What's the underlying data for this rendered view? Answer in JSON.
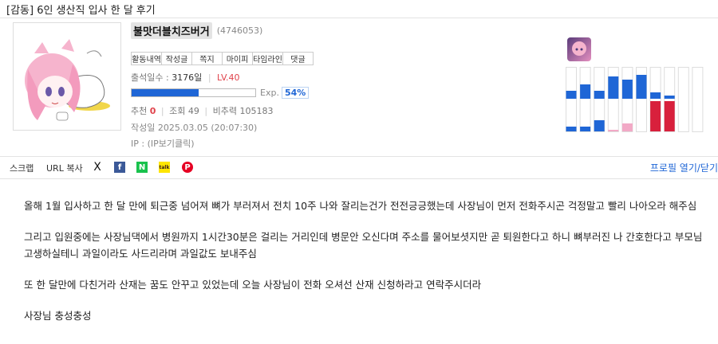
{
  "post": {
    "title": "[감동] 6인 생산직 입사 한 달 후기"
  },
  "author": {
    "nickname": "불맛더블치즈버거",
    "id": "(4746053)",
    "buttons": [
      "활동내역",
      "작성글",
      "쪽지",
      "마이피",
      "타임라인",
      "댓글"
    ],
    "attendance_label": "출석일수 :",
    "attendance_value": "3176일",
    "level": "LV.40",
    "exp_label": "Exp.",
    "exp_percent": "54%",
    "exp_fraction": 0.54
  },
  "stats": {
    "recommend_label": "추천",
    "recommend_value": "0",
    "views_label": "조회",
    "views_value": "49",
    "ratio_label": "비추력",
    "ratio_value": "105183"
  },
  "meta": {
    "date": "작성일 2025.03.05 (20:07:30)",
    "ip": "IP : (IP보기클릭)"
  },
  "share": {
    "scrap": "스크랩",
    "url_copy": "URL 복사",
    "x_icon": "X",
    "facebook_icon": "f",
    "naver_icon": "N",
    "kakao_icon": "talk",
    "pinterest_icon": "P",
    "profile_toggle": "프로필 열기/닫기"
  },
  "activity_chart": {
    "top_columns": [
      0.25,
      0.45,
      0.25,
      0.7,
      0.6,
      0.75,
      0.2,
      0.1,
      0,
      0
    ],
    "bottom_columns": [
      {
        "value": 0.15,
        "color": "#1f66d6"
      },
      {
        "value": 0.15,
        "color": "#1f66d6"
      },
      {
        "value": 0.35,
        "color": "#1f66d6"
      },
      {
        "value": 0.05,
        "color": "#f2a9c6"
      },
      {
        "value": 0.25,
        "color": "#f2a9c6"
      },
      {
        "value": 0,
        "color": "#1f66d6"
      },
      {
        "value": 0.95,
        "color": "#d8203c"
      },
      {
        "value": 0.95,
        "color": "#d8203c"
      },
      {
        "value": 0,
        "color": "#1f66d6"
      },
      {
        "value": 0,
        "color": "#1f66d6"
      }
    ]
  },
  "content": {
    "paragraphs": [
      "올해 1월 입사하고 한 달 만에 퇴근중 넘어져 뼈가 부러져서 전치 10주 나와 잘리는건가 전전긍긍했는데 사장님이 먼저 전화주시곤 걱정말고 빨리 나아오라 해주심",
      "그리고 입원중에는 사장님댁에서 병원까지 1시간30분은 걸리는 거리인데 병문안 오신다며 주소를 물어보셧지만 곧 퇴원한다고 하니 뼈부러진 나 간호한다고 부모님 고생하실테니 과일이라도 사드리라며 과일값도 보내주심",
      "또 한 달만에 다친거라 산재는 꿈도 안꾸고 있었는데 오늘 사장님이 전화 오셔선 산재 신청하라고 연락주시더라",
      "사장님 충성충성"
    ]
  }
}
